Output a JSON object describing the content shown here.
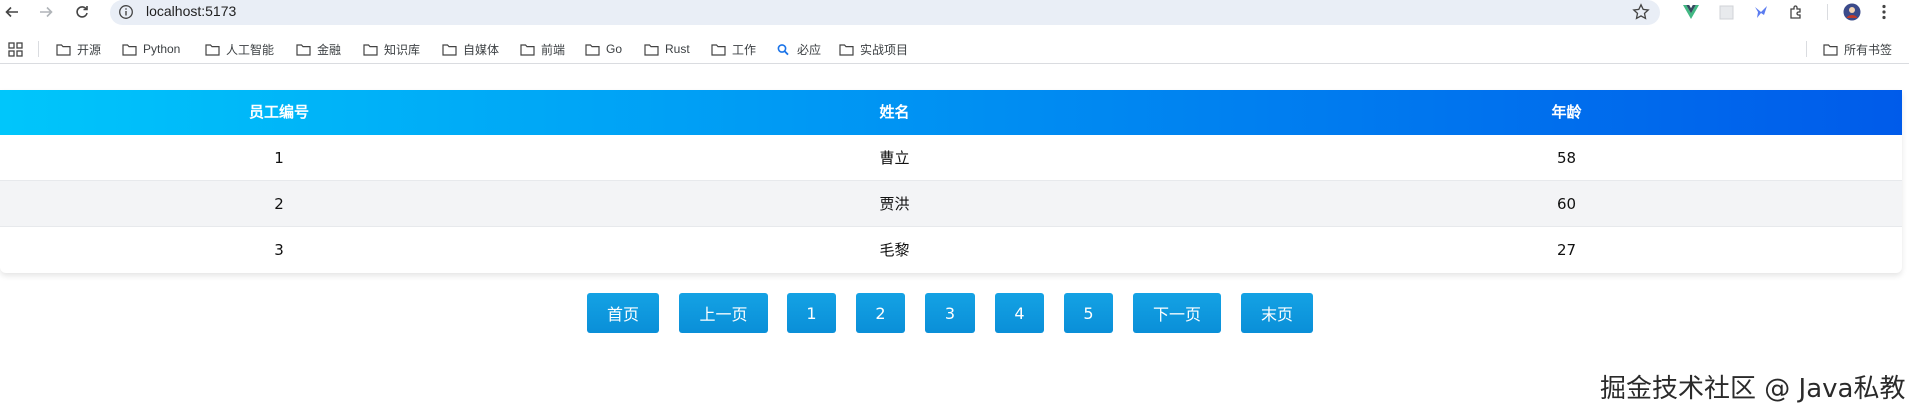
{
  "browser": {
    "url": "localhost:5173"
  },
  "bookmarks": [
    {
      "label": "开源",
      "icon": "folder-icon"
    },
    {
      "label": "Python",
      "icon": "folder-icon"
    },
    {
      "label": "人工智能",
      "icon": "folder-icon"
    },
    {
      "label": "金融",
      "icon": "folder-icon"
    },
    {
      "label": "知识库",
      "icon": "folder-icon"
    },
    {
      "label": "自媒体",
      "icon": "folder-icon"
    },
    {
      "label": "前端",
      "icon": "folder-icon"
    },
    {
      "label": "Go",
      "icon": "folder-icon"
    },
    {
      "label": "Rust",
      "icon": "folder-icon"
    },
    {
      "label": "工作",
      "icon": "folder-icon"
    },
    {
      "label": "必应",
      "icon": "search-icon"
    },
    {
      "label": "实战项目",
      "icon": "folder-icon"
    }
  ],
  "all_bookmarks_label": "所有书签",
  "table": {
    "headers": [
      "员工编号",
      "姓名",
      "年龄"
    ],
    "rows": [
      [
        "1",
        "曹立",
        "58"
      ],
      [
        "2",
        "贾洪",
        "60"
      ],
      [
        "3",
        "毛黎",
        "27"
      ]
    ],
    "header_gradient": [
      "#00c6fb",
      "#005bea"
    ]
  },
  "pagination": {
    "first": "首页",
    "prev": "上一页",
    "pages": [
      "1",
      "2",
      "3",
      "4",
      "5"
    ],
    "next": "下一页",
    "last": "末页",
    "button_color": "#0e96dc"
  },
  "watermark": {
    "text": "掘金技术社区 @ Java私教"
  }
}
